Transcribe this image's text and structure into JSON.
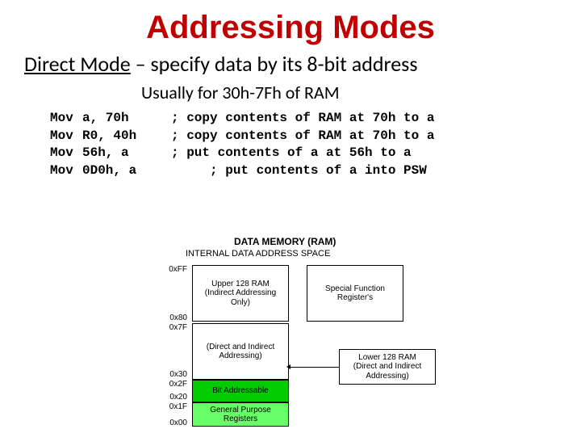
{
  "title": "Addressing Modes",
  "subtitle_mode": "Direct Mode",
  "subtitle_rest": " – specify data by its 8-bit address",
  "note": "Usually for 30h-7Fh of RAM",
  "code": [
    {
      "op": "Mov",
      "args": "a, 70h",
      "cmt": "; copy contents of RAM at 70h to a"
    },
    {
      "op": "Mov",
      "args": "R0, 40h",
      "cmt": "; copy contents of RAM at 70h to a"
    },
    {
      "op": "Mov",
      "args": "56h, a",
      "cmt": "; put contents of a at 56h to a"
    },
    {
      "op": "Mov",
      "args": "0D0h, a",
      "cmt": "     ; put contents of a into PSW"
    }
  ],
  "diagram": {
    "title": "DATA MEMORY (RAM)",
    "subtitle": "INTERNAL DATA  ADDRESS SPACE",
    "addrs": {
      "a0": "0xFF",
      "a1": "0x80",
      "a2": "0x7F",
      "a3": "0x30",
      "a4": "0x2F",
      "a5": "0x20",
      "a6": "0x1F",
      "a7": "0x00"
    },
    "upper": "Upper 128 RAM\n(Indirect Addressing\nOnly)",
    "lower_direct_indirect": "(Direct and Indirect\nAddressing)",
    "bit": "Bit Addressable",
    "gpr": "General Purpose\nRegisters",
    "sfr": "Special Function\nRegister's",
    "lower_right": "Lower 128 RAM\n(Direct and Indirect\nAddressing)"
  }
}
